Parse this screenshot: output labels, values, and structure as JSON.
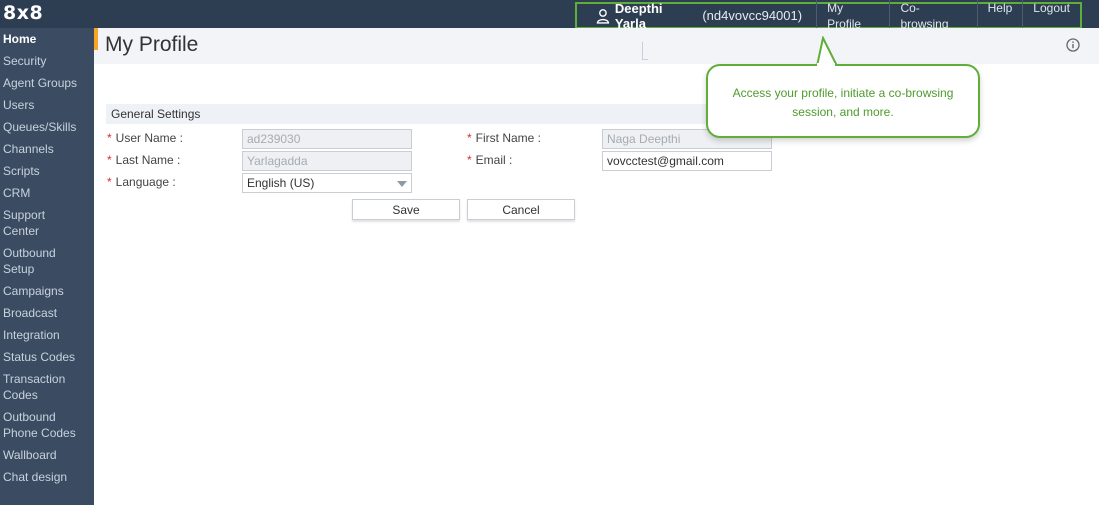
{
  "app": {
    "logo": "8x8"
  },
  "header": {
    "user_name": "Deepthi Yarla",
    "user_id": "(nd4vovcc94001)",
    "links": [
      "My Profile",
      "Co-browsing",
      "Help",
      "Logout"
    ]
  },
  "sidebar": {
    "items": [
      "Home",
      "Security",
      "Agent Groups",
      "Users",
      "Queues/Skills",
      "Channels",
      "Scripts",
      "CRM",
      "Support Center",
      "Outbound Setup",
      "Campaigns",
      "Broadcast",
      "Integration",
      "Status Codes",
      "Transaction Codes",
      "Outbound Phone Codes",
      "Wallboard",
      "Chat design"
    ]
  },
  "page": {
    "title": "My Profile"
  },
  "settings": {
    "section_title": "General Settings",
    "user_name_label": "User Name :",
    "user_name_value": "ad239030",
    "first_name_label": "First Name :",
    "first_name_value": "Naga Deepthi",
    "last_name_label": "Last Name :",
    "last_name_value": "Yarlagadda",
    "email_label": "Email :",
    "email_value": "vovcctest@gmail.com",
    "language_label": "Language :",
    "language_value": "English (US)",
    "save_label": "Save",
    "cancel_label": "Cancel",
    "required_mark": "*"
  },
  "tooltip": {
    "text": "Access your profile, initiate a co-browsing session, and more."
  },
  "colors": {
    "topbar": "#2e3e52",
    "sidebar": "#3b4c62",
    "highlight_green": "#5fae3a",
    "accent_orange": "#f6a623",
    "required_red": "#d0302f"
  }
}
